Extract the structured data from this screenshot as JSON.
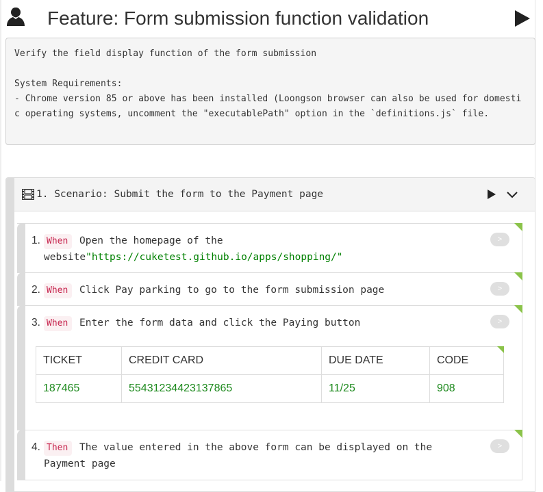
{
  "feature": {
    "title": "Feature: Form submission function validation",
    "icon": "person-icon",
    "run_icon": "play-icon",
    "description": "Verify the field display function of the form submission\n\nSystem Requirements:\n- Chrome version 85 or above has been installed (Loongson browser can also be used for domestic operating systems, uncomment the \"executablePath\" option in the `definitions.js` file."
  },
  "scenario": {
    "icon": "film-icon",
    "title": "1. Scenario: Submit the form to the Payment page",
    "run_icon": "play-icon",
    "toggle_icon": "chevron-down-icon"
  },
  "steps": [
    {
      "number": "1.",
      "keyword": "When",
      "text": "Open the homepage of the website",
      "string": "\"https://cuketest.github.io/apps/shopping/\"",
      "text_after": "",
      "status_color": "#8bc34a",
      "go_label": ">"
    },
    {
      "number": "2.",
      "keyword": "When",
      "text": "Click Pay parking to go to the form submission page",
      "string": "",
      "text_after": "",
      "status_color": "#8bc34a",
      "go_label": ">"
    },
    {
      "number": "3.",
      "keyword": "When",
      "text": "Enter the form data and click the Paying button",
      "string": "",
      "text_after": "",
      "status_color": "#8bc34a",
      "go_label": ">",
      "table": {
        "headers": [
          "TICKET",
          "CREDIT CARD",
          "DUE DATE",
          "CODE"
        ],
        "rows": [
          [
            "187465",
            "55431234423137865",
            "11/25",
            "908"
          ]
        ]
      }
    },
    {
      "number": "4.",
      "keyword": "Then",
      "text": "The value entered in the above form can be displayed on the Payment page",
      "string": "",
      "text_after": "",
      "status_color": "#8bc34a",
      "go_label": ">"
    }
  ]
}
